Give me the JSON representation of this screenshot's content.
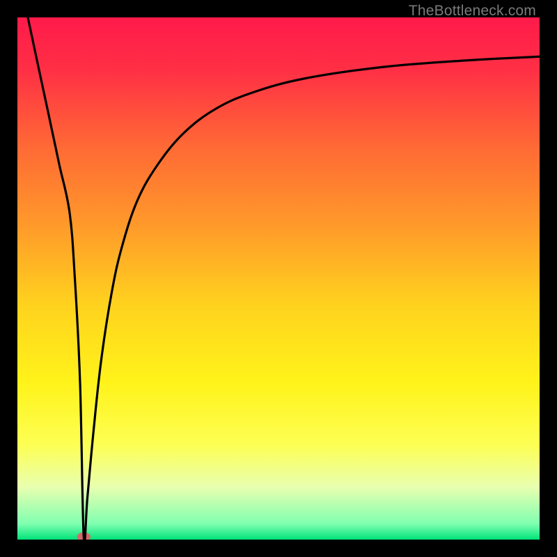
{
  "watermark": "TheBottleneck.com",
  "chart_data": {
    "type": "line",
    "title": "",
    "xlabel": "",
    "ylabel": "",
    "xlim": [
      0,
      100
    ],
    "ylim": [
      0,
      100
    ],
    "grid": false,
    "background_gradient": {
      "stops": [
        {
          "offset": 0.0,
          "color": "#ff1a4a"
        },
        {
          "offset": 0.1,
          "color": "#ff2f45"
        },
        {
          "offset": 0.25,
          "color": "#ff6a35"
        },
        {
          "offset": 0.4,
          "color": "#ff9a2a"
        },
        {
          "offset": 0.55,
          "color": "#ffd21e"
        },
        {
          "offset": 0.7,
          "color": "#fff31a"
        },
        {
          "offset": 0.82,
          "color": "#fdff55"
        },
        {
          "offset": 0.9,
          "color": "#e8ffb0"
        },
        {
          "offset": 0.97,
          "color": "#7fffb0"
        },
        {
          "offset": 1.0,
          "color": "#00e37a"
        }
      ]
    },
    "series": [
      {
        "name": "bottleneck-curve",
        "color": "#000000",
        "x": [
          2.0,
          4.0,
          6.0,
          8.0,
          10.0,
          11.0,
          12.0,
          12.7,
          13.4,
          14.5,
          16.0,
          18.0,
          20.0,
          23.0,
          27.0,
          32.0,
          38.0,
          45.0,
          55.0,
          70.0,
          85.0,
          100.0
        ],
        "y": [
          100,
          90.6,
          81.3,
          71.9,
          62.6,
          50.0,
          30.0,
          0.5,
          8.0,
          20.0,
          34.0,
          47.0,
          56.0,
          65.0,
          72.0,
          78.0,
          82.5,
          85.6,
          88.3,
          90.5,
          91.7,
          92.5
        ]
      }
    ],
    "marker": {
      "name": "minimum-marker",
      "x": 12.7,
      "y": 0.5,
      "rx": 1.3,
      "ry": 0.9,
      "fill": "#d46a6a"
    }
  }
}
